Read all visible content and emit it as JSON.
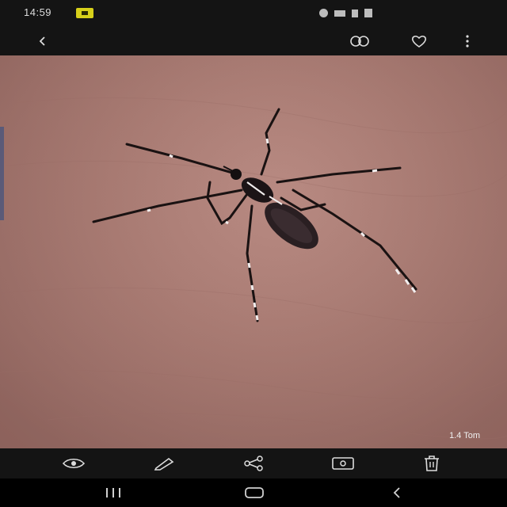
{
  "status_bar": {
    "time": "14:59",
    "notification_icon": "app-badge-icon",
    "right_icons": [
      "alarm-icon",
      "wifi-icon",
      "signal-icon",
      "battery-icon"
    ]
  },
  "top_bar": {
    "back_icon": "back-arrow-icon",
    "remaster_icon": "remaster-icon",
    "favorite_icon": "heart-icon",
    "more_icon": "more-vertical-icon"
  },
  "photo": {
    "subject": "mosquito-image",
    "zoom_label": "1.4 Tom"
  },
  "bottom_toolbar": {
    "items": [
      {
        "icon": "eye-icon"
      },
      {
        "icon": "pencil-icon"
      },
      {
        "icon": "share-icon"
      },
      {
        "icon": "cast-icon"
      },
      {
        "icon": "trash-icon"
      }
    ]
  },
  "nav_bar": {
    "items": [
      {
        "icon": "recents-icon"
      },
      {
        "icon": "home-icon"
      },
      {
        "icon": "nav-back-icon"
      }
    ]
  },
  "colors": {
    "bar_background": "#141414",
    "skin": "#a87a72",
    "icon": "#dcdcdc"
  }
}
